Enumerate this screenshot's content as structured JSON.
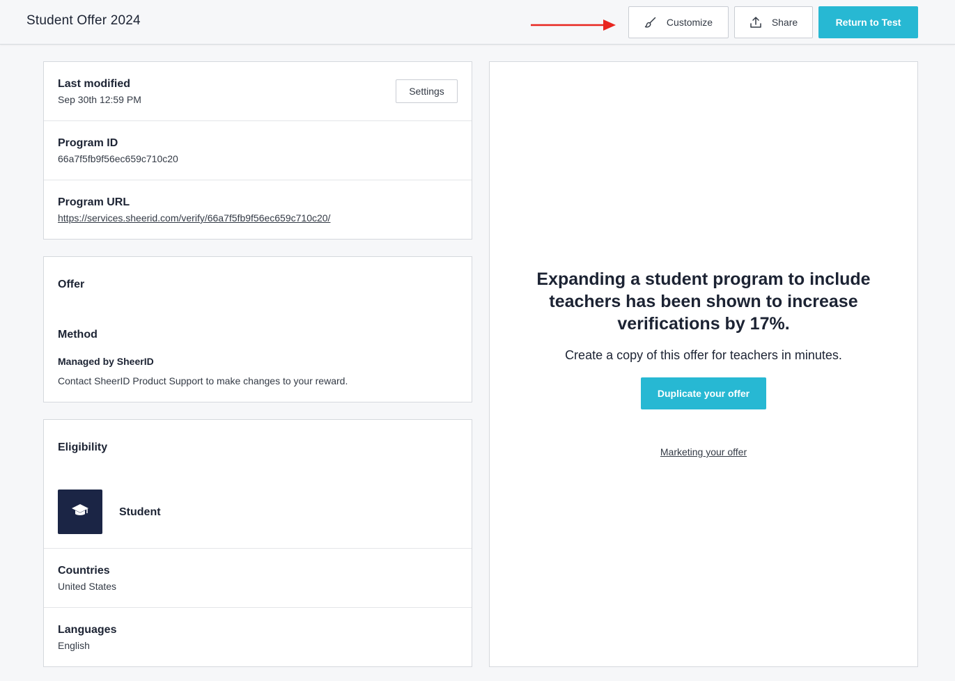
{
  "header": {
    "title": "Student Offer 2024",
    "customize_label": "Customize",
    "share_label": "Share",
    "return_label": "Return to Test",
    "accent_color": "#27b8d3",
    "annotation_arrow_color": "#e8251f"
  },
  "program_info": {
    "last_modified_label": "Last modified",
    "last_modified_value": "Sep 30th 12:59 PM",
    "settings_label": "Settings",
    "program_id_label": "Program ID",
    "program_id_value": "66a7f5fb9f56ec659c710c20",
    "program_url_label": "Program URL",
    "program_url_value": "https://services.sheerid.com/verify/66a7f5fb9f56ec659c710c20/"
  },
  "offer": {
    "offer_label": "Offer",
    "method_label": "Method",
    "managed_by": "Managed by SheerID",
    "contact_text": "Contact SheerID Product Support to make changes to your reward."
  },
  "eligibility": {
    "label": "Eligibility",
    "segment": "Student",
    "segment_icon": "graduation-cap-icon",
    "countries_label": "Countries",
    "countries_value": "United States",
    "languages_label": "Languages",
    "languages_value": "English"
  },
  "promo": {
    "heading": "Expanding a student program to include teachers has been shown to increase verifications by 17%.",
    "subtext": "Create a copy of this offer for teachers in minutes.",
    "duplicate_label": "Duplicate your offer",
    "marketing_link": "Marketing your offer"
  }
}
